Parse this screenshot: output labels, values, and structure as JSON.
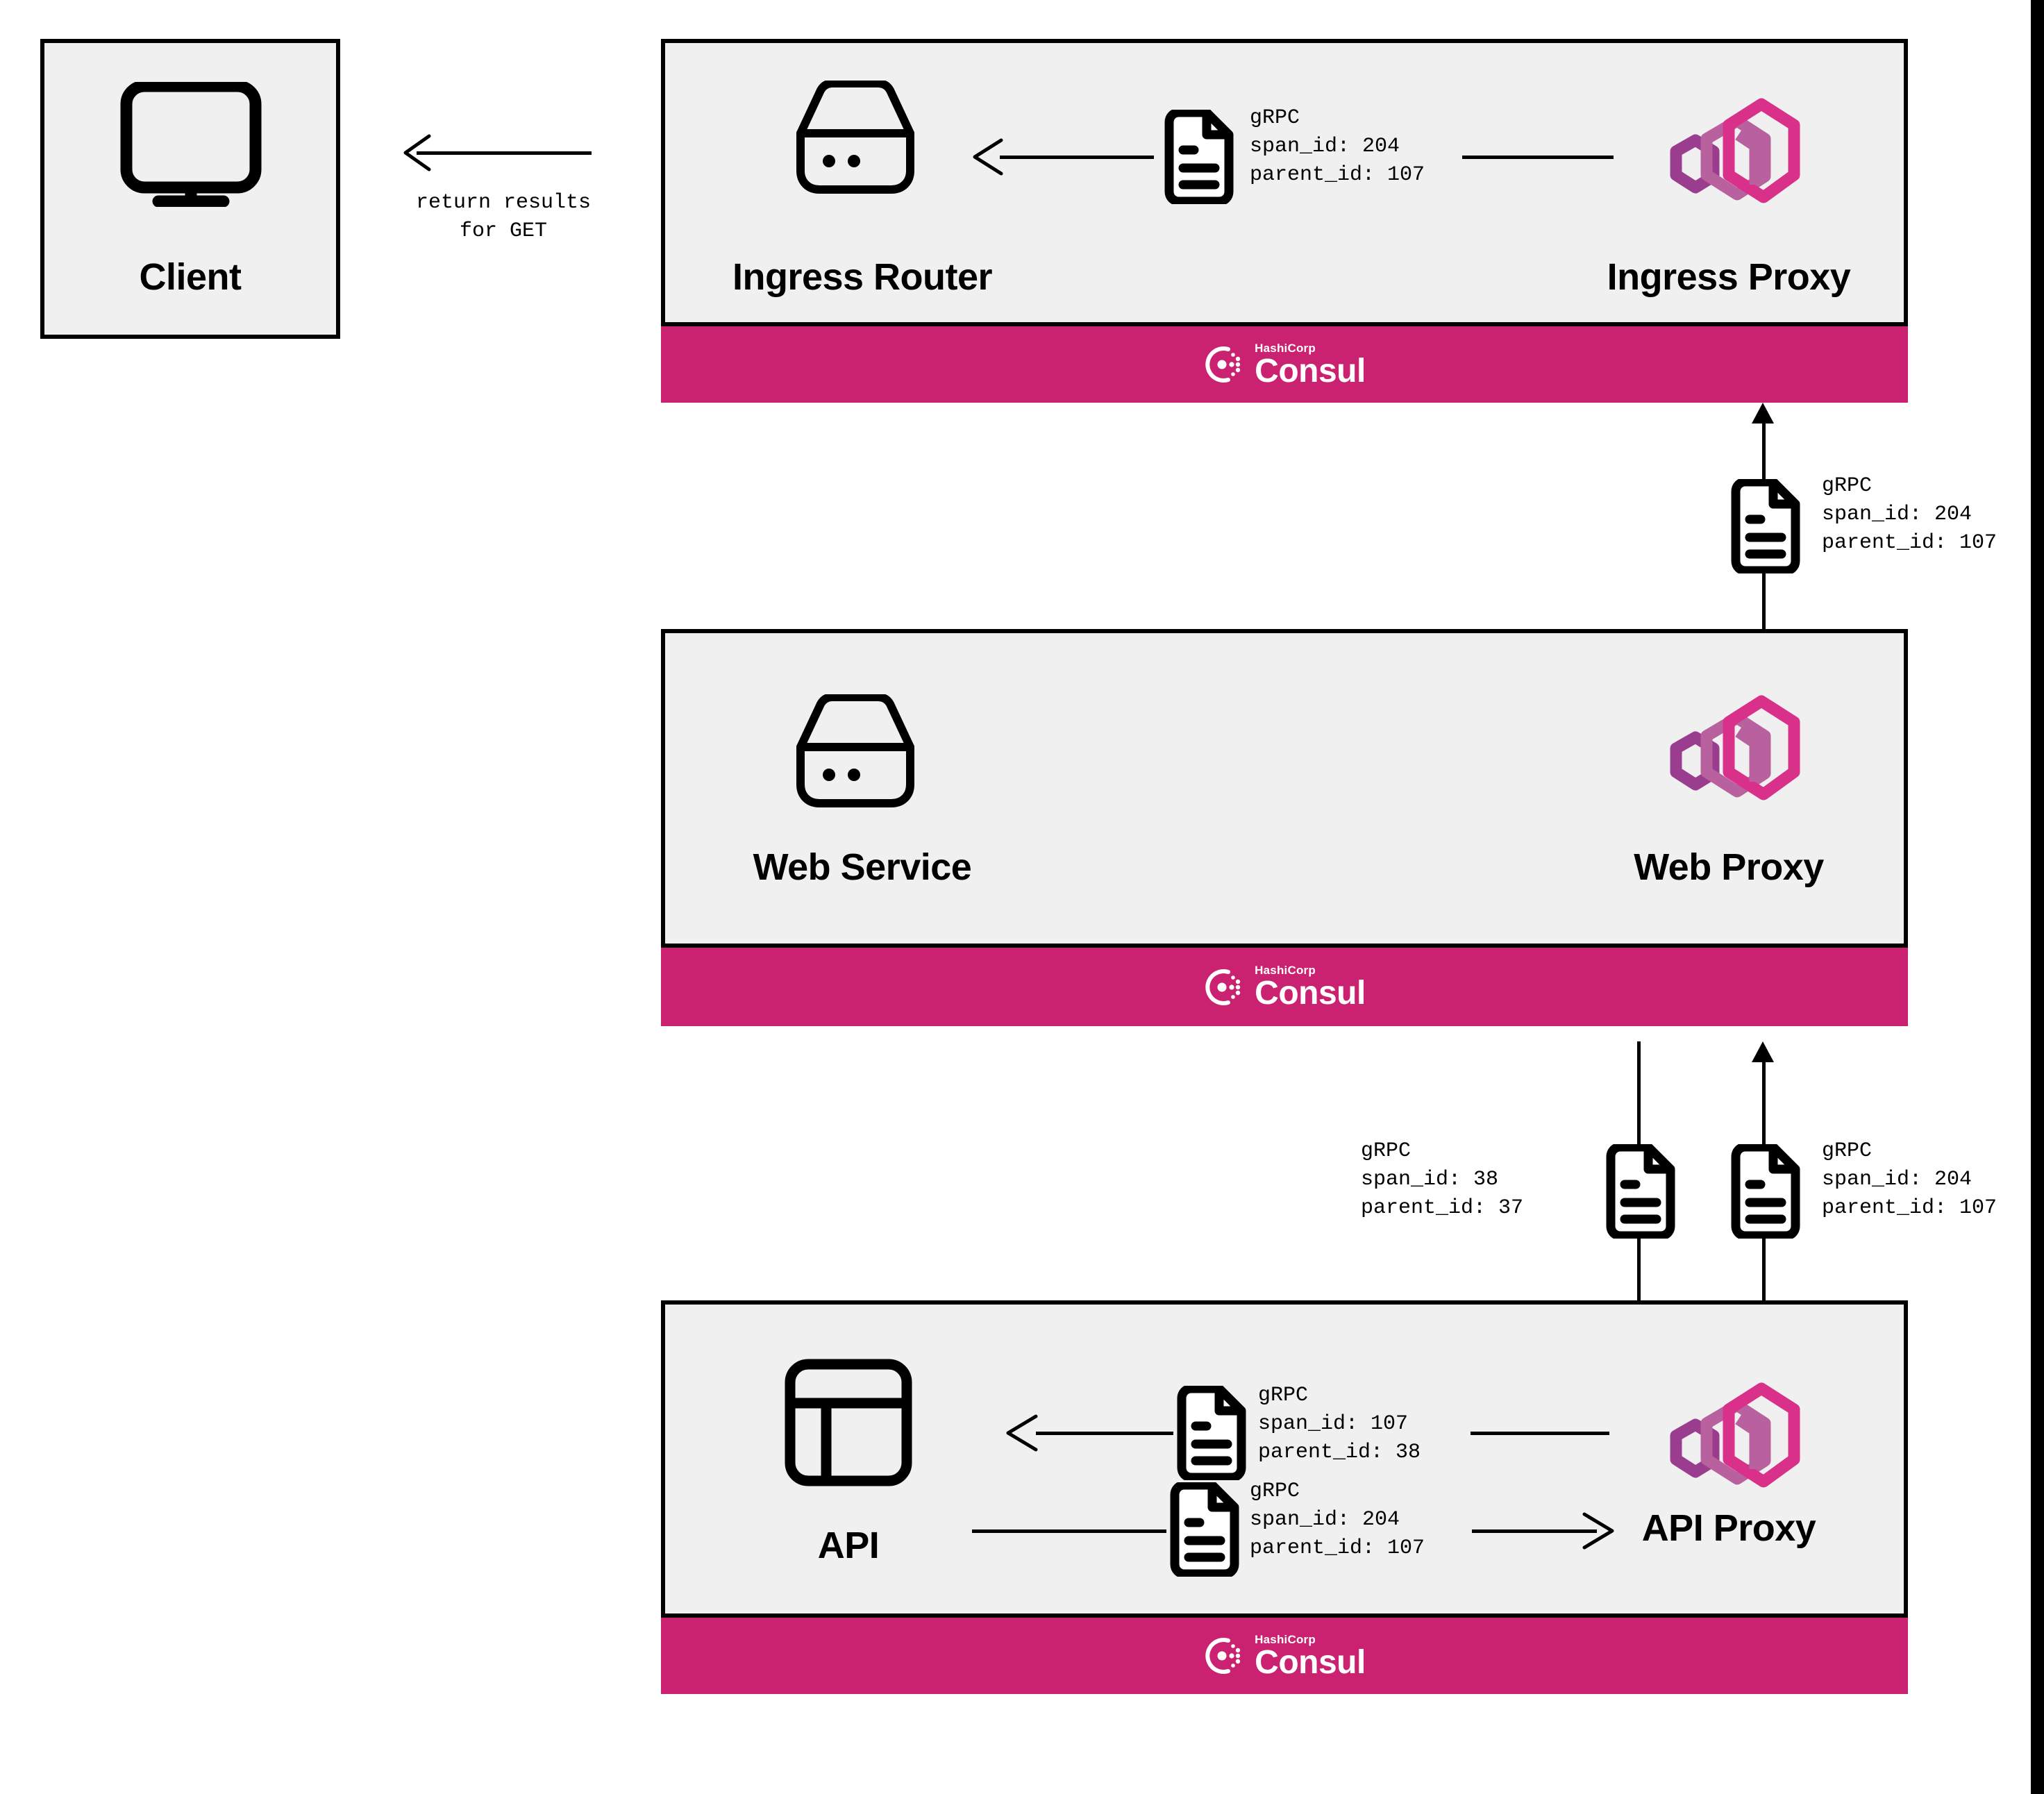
{
  "diagram": {
    "title": "Consul service mesh distributed tracing flow",
    "colors": {
      "consul_pink": "#ca2171",
      "box_fill": "#f0f0f0",
      "stroke": "#000000",
      "proxy_hex_dark": "#9b3d8f",
      "proxy_hex_mid": "#b8619e",
      "proxy_hex_bright": "#d9308a"
    }
  },
  "client": {
    "label": "Client",
    "icon": "monitor-icon"
  },
  "return_arrow": {
    "line1": "return results",
    "line2": "for GET"
  },
  "ingress": {
    "service_label": "Ingress Router",
    "service_icon": "server-icon",
    "proxy_label": "Ingress Proxy",
    "proxy_icon": "consul-proxy-hexagons-icon",
    "consul_bar": {
      "brand": "HashiCorp",
      "product": "Consul"
    },
    "span": {
      "protocol": "gRPC",
      "span_id": "span_id: 204",
      "parent_id": "parent_id: 107"
    }
  },
  "web": {
    "service_label": "Web Service",
    "service_icon": "server-icon",
    "proxy_label": "Web Proxy",
    "proxy_icon": "consul-proxy-hexagons-icon",
    "consul_bar": {
      "brand": "HashiCorp",
      "product": "Consul"
    }
  },
  "api": {
    "service_label": "API",
    "service_icon": "api-panel-icon",
    "proxy_label": "API Proxy",
    "proxy_icon": "consul-proxy-hexagons-icon",
    "consul_bar": {
      "brand": "HashiCorp",
      "product": "Consul"
    },
    "span_in": {
      "protocol": "gRPC",
      "span_id": "span_id: 107",
      "parent_id": "parent_id: 38"
    },
    "span_out": {
      "protocol": "gRPC",
      "span_id": "span_id: 204",
      "parent_id": "parent_id: 107"
    }
  },
  "edges": {
    "ingress_proxy_up": {
      "protocol": "gRPC",
      "span_id": "span_id: 204",
      "parent_id": "parent_id: 107"
    },
    "web_to_api_down": {
      "protocol": "gRPC",
      "span_id": "span_id: 38",
      "parent_id": "parent_id: 37"
    },
    "api_to_web_up": {
      "protocol": "gRPC",
      "span_id": "span_id: 204",
      "parent_id": "parent_id: 107"
    }
  }
}
